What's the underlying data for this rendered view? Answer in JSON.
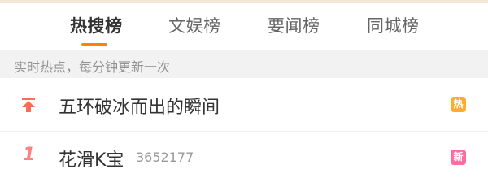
{
  "tabs": [
    {
      "label": "热搜榜",
      "active": true
    },
    {
      "label": "文娱榜",
      "active": false
    },
    {
      "label": "要闻榜",
      "active": false
    },
    {
      "label": "同城榜",
      "active": false
    }
  ],
  "notice": "实时热点，每分钟更新一次",
  "items": [
    {
      "rank_icon": "pin-top-icon",
      "title": "五环破冰而出的瞬间",
      "count": "",
      "badge": "热",
      "badge_color": "#ffab2d"
    },
    {
      "rank": "1",
      "title": "花滑K宝",
      "count": "3652177",
      "badge": "新",
      "badge_color": "#ff6ba0"
    }
  ],
  "colors": {
    "accent": "#ff8200",
    "pin": "#ff6b5a",
    "rank": "#ff8080"
  }
}
